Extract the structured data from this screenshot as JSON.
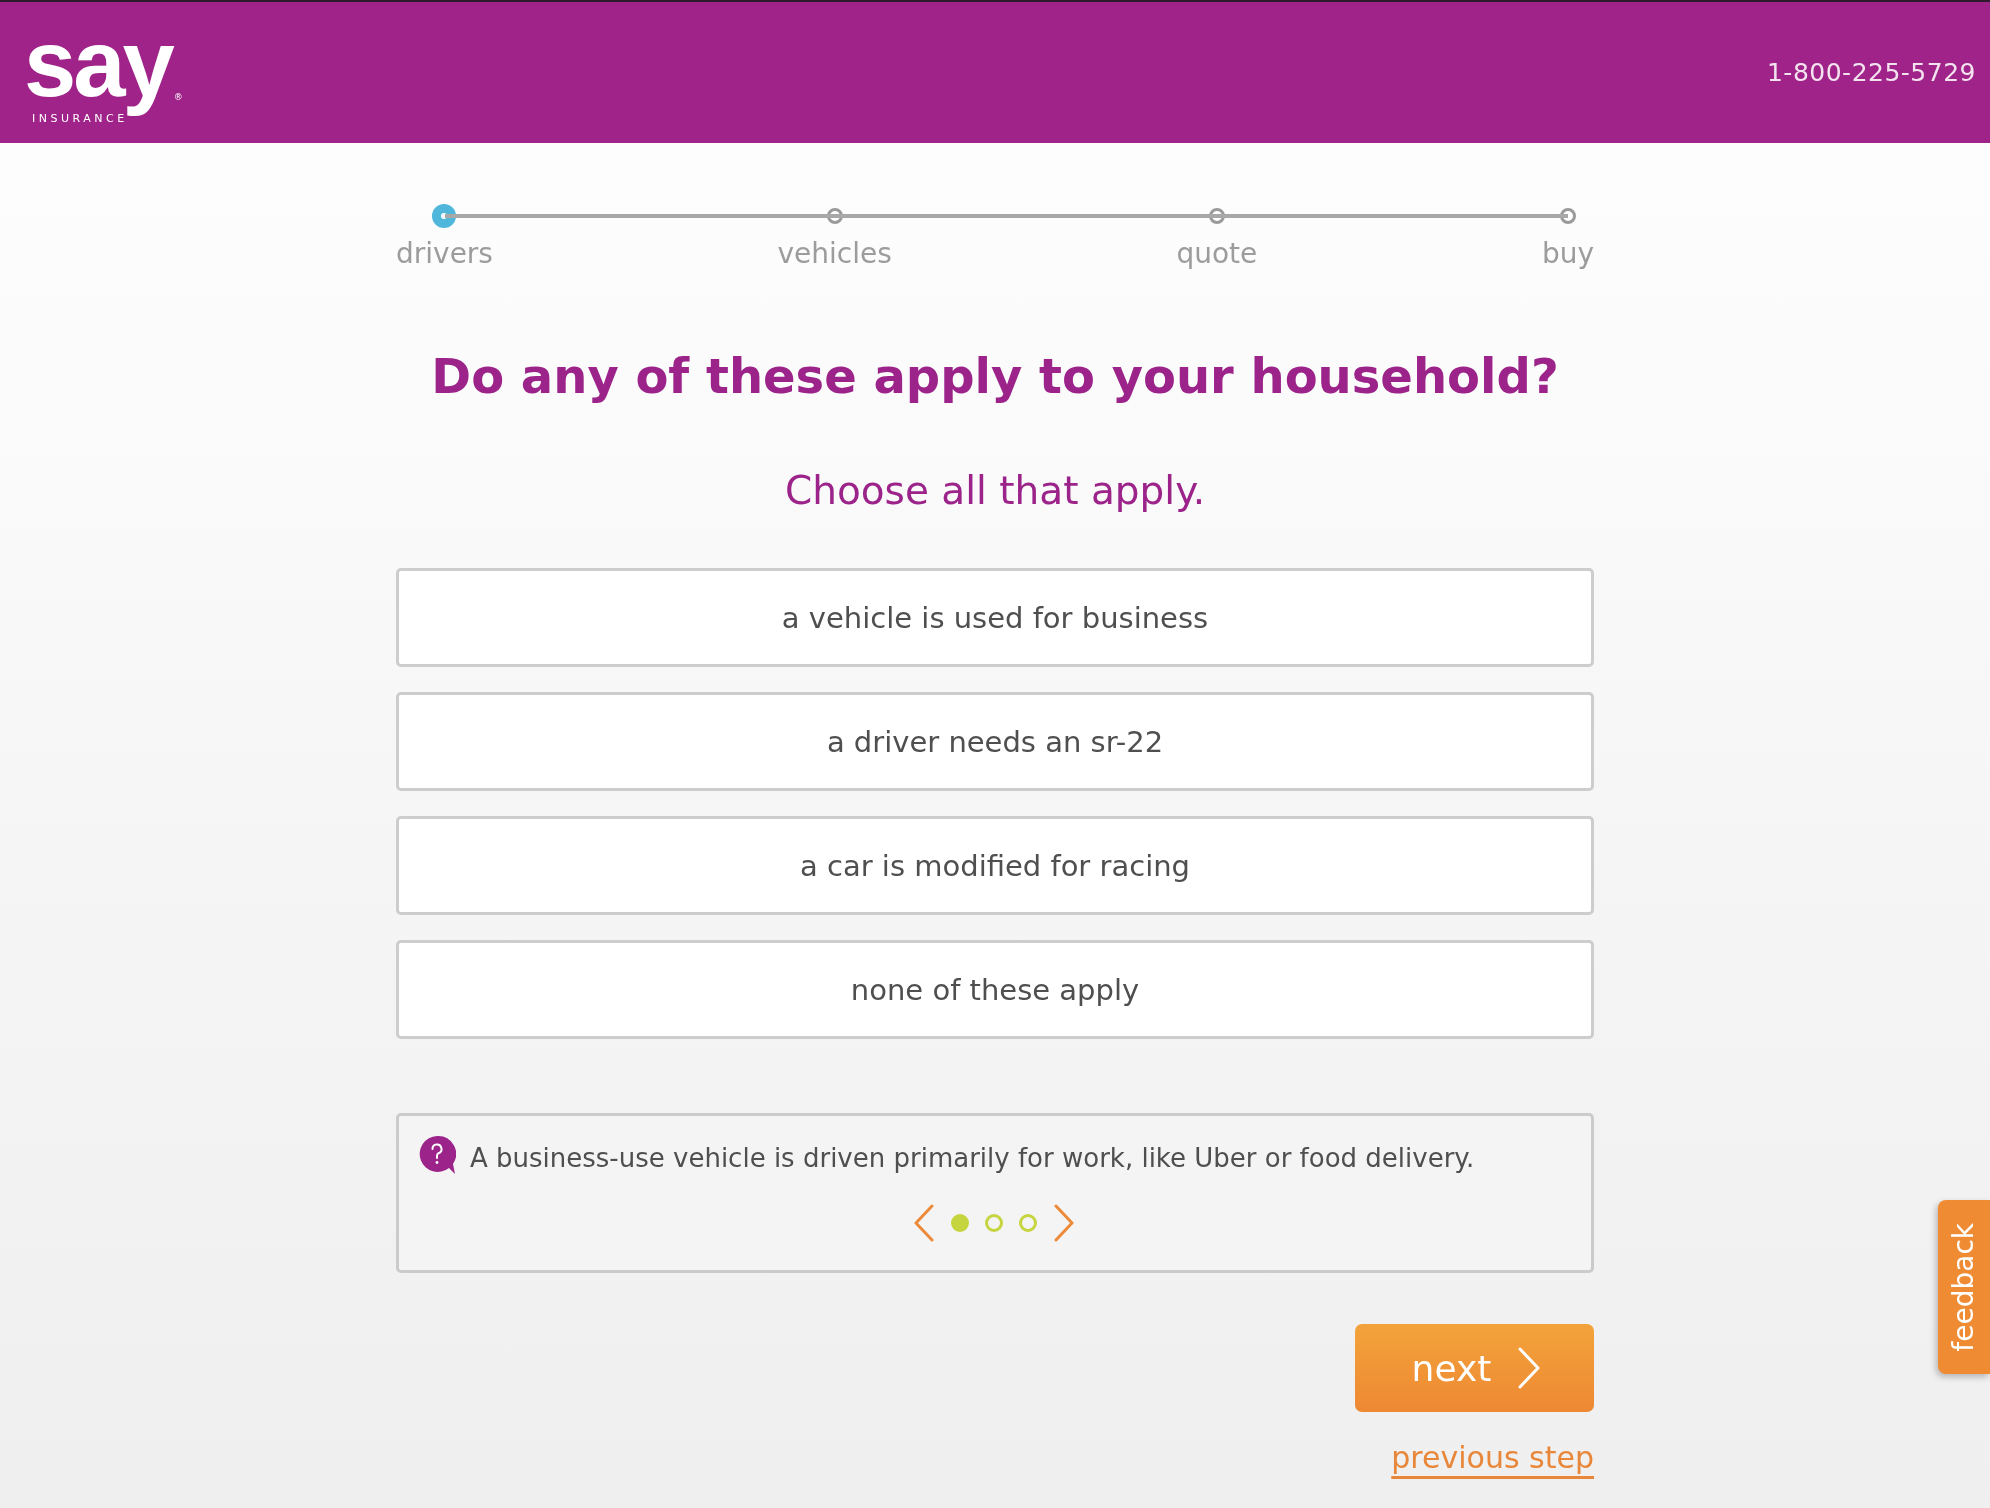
{
  "header": {
    "logo": {
      "wordmark": "say",
      "tagline": "INSURANCE",
      "mark": "®"
    },
    "phone": "1-800-225-5729"
  },
  "stepper": [
    {
      "label": "drivers",
      "current": true
    },
    {
      "label": "vehicles",
      "current": false
    },
    {
      "label": "quote",
      "current": false
    },
    {
      "label": "buy",
      "current": false
    }
  ],
  "question": {
    "title": "Do any of these apply to your household?",
    "instruction": "Choose all that apply."
  },
  "options": [
    {
      "label": "a vehicle is used for business",
      "selected": false
    },
    {
      "label": "a driver needs an sr-22",
      "selected": false
    },
    {
      "label": "a car is modified for racing",
      "selected": false
    },
    {
      "label": "none of these apply",
      "selected": false
    }
  ],
  "tip": {
    "text": "A business-use vehicle is driven primarily for work, like Uber or food delivery.",
    "slides": [
      {
        "selected": true
      },
      {
        "selected": false
      },
      {
        "selected": false
      }
    ]
  },
  "actions": {
    "next": "next",
    "previous": "previous step"
  },
  "feedback_tab": "feedback"
}
